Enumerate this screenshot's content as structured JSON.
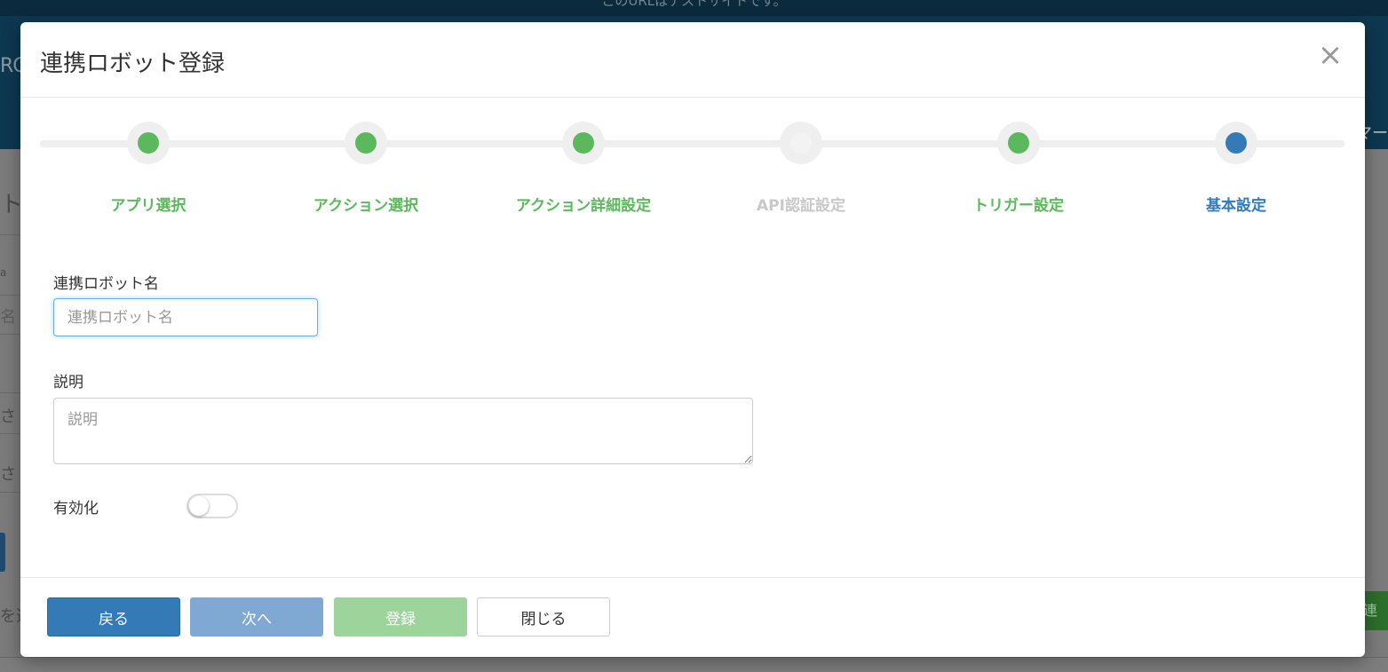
{
  "background": {
    "banner_text": "このURLはテストサイトです。",
    "logo_fragment": "RC",
    "header_right_fragment": "マー",
    "left_fragments": [
      "ト",
      "a",
      "名",
      "さ",
      "さ",
      "を選"
    ],
    "right_button_fragment": "連"
  },
  "modal": {
    "title": "連携ロボット登録",
    "close_symbol": "×"
  },
  "steps": [
    {
      "label": "アプリ選択",
      "state": "done"
    },
    {
      "label": "アクション選択",
      "state": "done"
    },
    {
      "label": "アクション詳細設定",
      "state": "done"
    },
    {
      "label": "API認証設定",
      "state": "inactive"
    },
    {
      "label": "トリガー設定",
      "state": "done"
    },
    {
      "label": "基本設定",
      "state": "active"
    }
  ],
  "form": {
    "robot_name_label": "連携ロボット名",
    "robot_name_placeholder": "連携ロボット名",
    "robot_name_value": "",
    "description_label": "説明",
    "description_placeholder": "説明",
    "description_value": "",
    "enable_label": "有効化",
    "enable_on": false
  },
  "footer": {
    "back_label": "戻る",
    "next_label": "次へ",
    "register_label": "登録",
    "close_label": "閉じる"
  },
  "colors": {
    "done": "#5cb85c",
    "active": "#337ab7",
    "inactive": "#c8c8c8",
    "primary": "#337ab7",
    "success_disabled": "#9cd49c",
    "primary_disabled": "#7fa9d3"
  }
}
